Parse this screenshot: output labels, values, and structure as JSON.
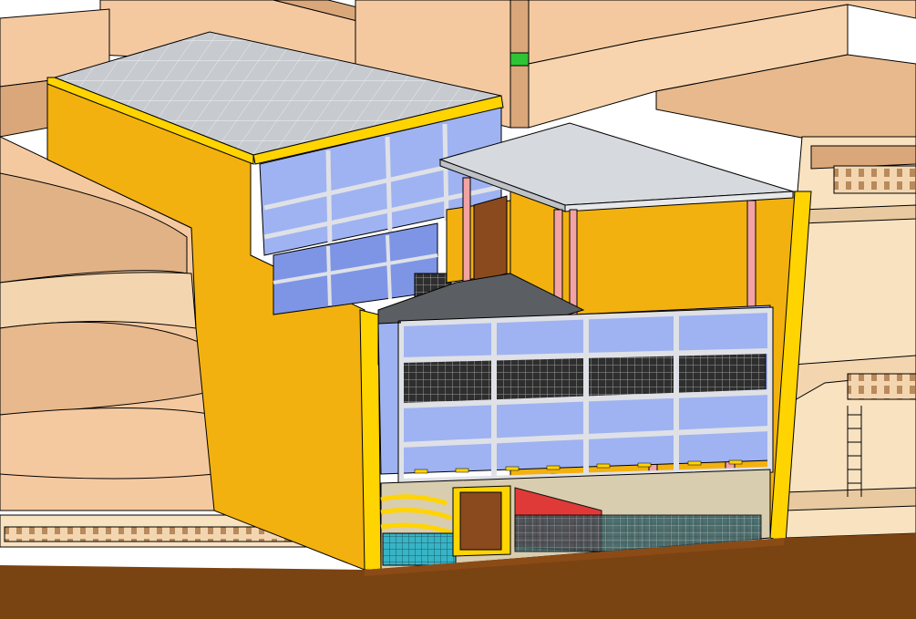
{
  "scene": {
    "description_free": true,
    "palette": {
      "sky": "#ffffff",
      "ground": "#7a4312",
      "ground_light": "#8b4b16",
      "facade_yellow": "#f2b10e",
      "facade_yellow_dark": "#e3a000",
      "facade_edge": "#ffd400",
      "neighbor_peach": "#f5c9a0",
      "neighbor_peach_dark": "#d9a77a",
      "neighbor_cream": "#f8e2c0",
      "roof_gray": "#c9ccd0",
      "roof_tile_line": "#ffffff",
      "glass_blue": "#9fb3f2",
      "glass_dark": "#4f6ad1",
      "frame_light": "#dfe1e6",
      "pilotis_pink": "#f3a3a3",
      "mesh_dark": "#333333",
      "mesh_cyan": "#3fb8c8",
      "door_brown": "#8a4a1e",
      "green_accent": "#2ec436",
      "floor_dark": "#5b5e62"
    }
  }
}
